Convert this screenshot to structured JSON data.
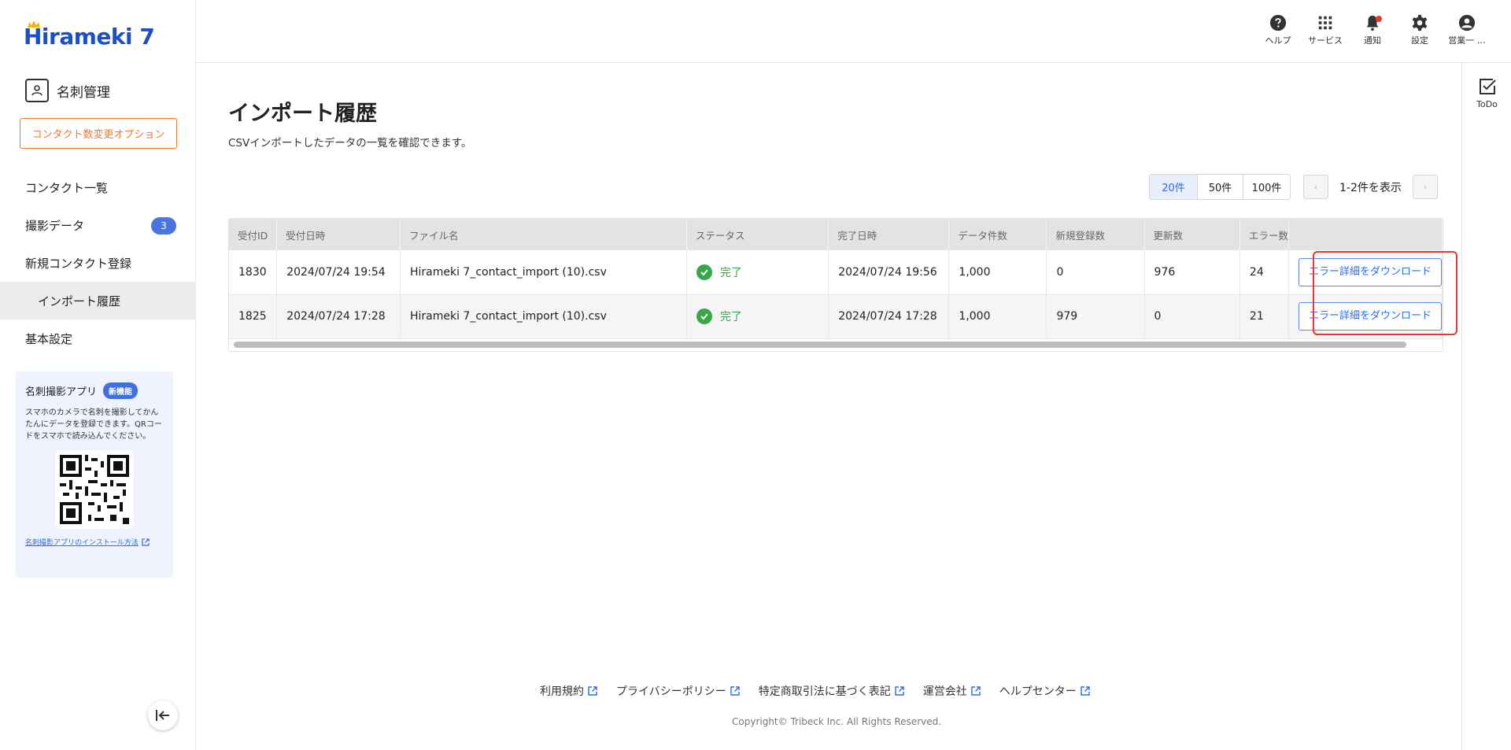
{
  "brand": {
    "logo_text": "Hirameki 7",
    "app_name": "名刺管理"
  },
  "sidebar": {
    "option_button": "コンタクト数変更オプション",
    "items": [
      {
        "label": "コンタクト一覧"
      },
      {
        "label": "撮影データ",
        "badge": "3"
      },
      {
        "label": "新規コンタクト登録"
      },
      {
        "label": "インポート履歴"
      },
      {
        "label": "基本設定"
      }
    ],
    "promo": {
      "title": "名刺撮影アプリ",
      "badge": "新機能",
      "description": "スマホのカメラで名刺を撮影してかんたんにデータを登録できます。QRコードをスマホで読み込んでください。",
      "link": "名刺撮影アプリのインストール方法"
    }
  },
  "header": {
    "help": "ヘルプ",
    "services": "サービス",
    "notifications": "通知",
    "settings": "設定",
    "user": "営業一 …"
  },
  "todo": {
    "label": "ToDo"
  },
  "main": {
    "title": "インポート履歴",
    "description": "CSVインポートしたデータの一覧を確認できます。",
    "pager": {
      "sizes": [
        "20件",
        "50件",
        "100件"
      ],
      "active_size": "20件",
      "range_text": "1-2件を表示",
      "prev": "‹",
      "next": "›"
    },
    "table": {
      "columns": [
        "受付ID",
        "受付日時",
        "ファイル名",
        "ステータス",
        "完了日時",
        "データ件数",
        "新規登録数",
        "更新数",
        "エラー数"
      ],
      "rows": [
        {
          "id": "1830",
          "received": "2024/07/24 19:54",
          "file": "Hirameki 7_contact_import (10).csv",
          "status": "完了",
          "completed": "2024/07/24 19:56",
          "count": "1,000",
          "new": "0",
          "updated": "976",
          "errors": "24",
          "action": "エラー詳細をダウンロード"
        },
        {
          "id": "1825",
          "received": "2024/07/24 17:28",
          "file": "Hirameki 7_contact_import (10).csv",
          "status": "完了",
          "completed": "2024/07/24 17:28",
          "count": "1,000",
          "new": "979",
          "updated": "0",
          "errors": "21",
          "action": "エラー詳細をダウンロード"
        }
      ]
    }
  },
  "footer": {
    "links": [
      "利用規約",
      "プライバシーポリシー",
      "特定商取引法に基づく表記",
      "運営会社",
      "ヘルプセンター"
    ],
    "copyright": "Copyright© Tribeck Inc. All Rights Reserved."
  },
  "colors": {
    "brand_blue": "#1a4fc9",
    "accent_orange": "#f07832",
    "link_blue": "#2f6ce6",
    "success_green": "#37a74a",
    "highlight_red": "#e53935"
  }
}
